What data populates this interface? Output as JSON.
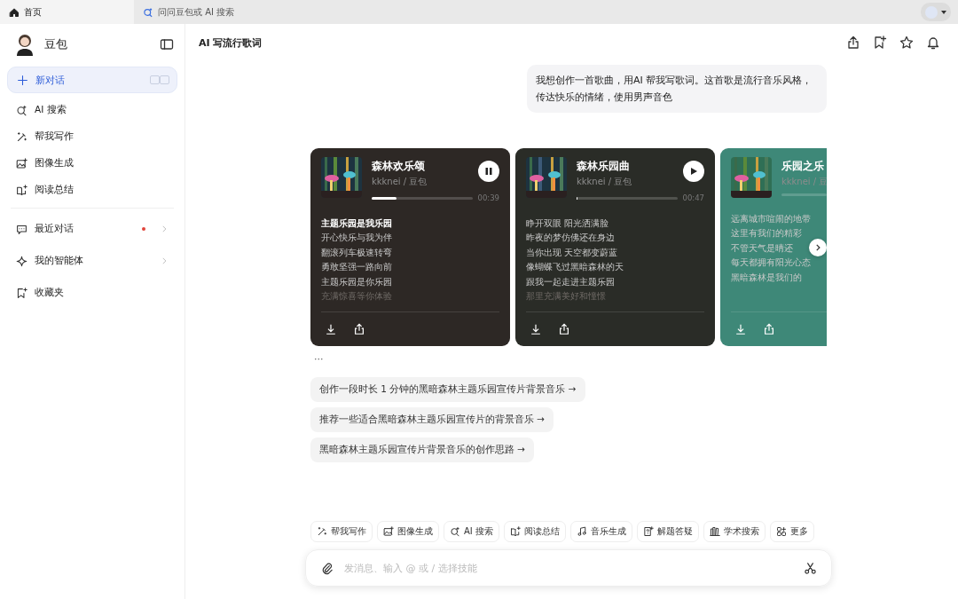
{
  "tabs": [
    {
      "label": "首页",
      "selected": true
    },
    {
      "label": "问问豆包或 AI 搜索",
      "selected": false
    }
  ],
  "sidebar": {
    "app_name": "豆包",
    "new_chat": {
      "label": "新对话",
      "selected": true
    },
    "items": [
      {
        "label": "AI 搜索",
        "selected": false
      },
      {
        "label": "帮我写作",
        "selected": false
      },
      {
        "label": "图像生成",
        "selected": false
      },
      {
        "label": "阅读总结",
        "selected": false
      }
    ],
    "secondary": [
      {
        "label": "最近对话",
        "unread": true,
        "expandable": true
      },
      {
        "label": "我的智能体",
        "unread": false,
        "expandable": true
      },
      {
        "label": "收藏夹",
        "unread": false,
        "expandable": false
      }
    ]
  },
  "chat": {
    "title": "AI 写流行歌词",
    "user_message": "我想创作一首歌曲，用AI 帮我写歌词。这首歌是流行音乐风格，传达快乐的情绪，使用男声音色",
    "songs": [
      {
        "title": "森林欢乐颂",
        "meta": "kkknei / 豆包",
        "playing": true,
        "level": 0.25,
        "time": "00:39",
        "color": "#2d2825",
        "lyrics": [
          {
            "text": "主题乐园是我乐园",
            "current": true
          },
          {
            "text": "开心快乐与我为伴",
            "current": false
          },
          {
            "text": "翻滚列车极速转弯",
            "current": false
          },
          {
            "text": "勇敢坚强一路向前",
            "current": false
          },
          {
            "text": "主题乐园是你乐园",
            "current": false
          },
          {
            "text": "充满惊喜等你体验",
            "current": false
          }
        ]
      },
      {
        "title": "森林乐园曲",
        "meta": "kkknei / 豆包",
        "playing": false,
        "level": 0.01,
        "time": "00:47",
        "color": "#2a2c27",
        "lyrics": [
          {
            "text": "睁开双眼 阳光洒满脸",
            "current": false
          },
          {
            "text": "昨夜的梦仿佛还在身边",
            "current": false
          },
          {
            "text": "当你出现 天空都变蔚蓝",
            "current": false
          },
          {
            "text": "像蝴蝶飞过黑暗森林的天",
            "current": false
          },
          {
            "text": "跟我一起走进主题乐园",
            "current": false
          },
          {
            "text": "那里充满美好和憧憬",
            "current": false
          }
        ]
      },
      {
        "title": "乐园之乐",
        "meta": "kkknei / 豆",
        "color": "#3e8878",
        "lyrics": [
          {
            "text": "远离城市喧闹的地带",
            "current": false
          },
          {
            "text": "这里有我们的精彩",
            "current": false
          },
          {
            "text": "不管天气是晴还",
            "current": false
          },
          {
            "text": "每天都拥有阳光心态",
            "current": false
          },
          {
            "text": "黑暗森林是我们的",
            "current": false
          }
        ]
      }
    ],
    "more": "···",
    "suggestions": [
      "创作一段时长 1 分钟的黑暗森林主题乐园宣传片背景音乐 →",
      "推荐一些适合黑暗森林主题乐园宣传片的背景音乐 →",
      "黑暗森林主题乐园宣传片背景音乐的创作思路 →"
    ]
  },
  "composer": {
    "skills": [
      "帮我写作",
      "图像生成",
      "AI 搜索",
      "阅读总结",
      "音乐生成",
      "解题答疑",
      "学术搜索",
      "更多"
    ],
    "placeholder": "发消息、输入 @ 或 / 选择技能"
  }
}
